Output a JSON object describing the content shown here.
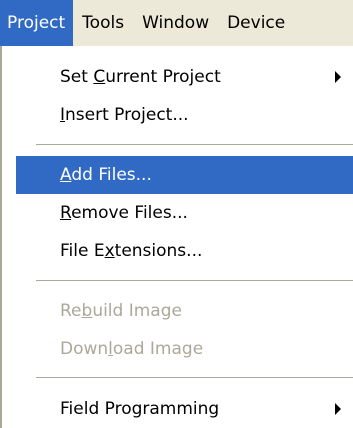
{
  "menubar": {
    "items": [
      "Project",
      "Tools",
      "Window",
      "Device"
    ],
    "active": "Project"
  },
  "menu": {
    "set_current_project": {
      "label": "Set Current Project",
      "mnemonic": "C",
      "has_submenu": true
    },
    "insert_project": {
      "label": "Insert Project...",
      "mnemonic": "I"
    },
    "add_files": {
      "label": "Add Files...",
      "mnemonic": "A",
      "highlighted": true
    },
    "remove_files": {
      "label": "Remove Files...",
      "mnemonic": "R"
    },
    "file_extensions": {
      "label": "File Extensions...",
      "mnemonic": "x"
    },
    "rebuild_image": {
      "label": "Rebuild Image",
      "mnemonic": "b",
      "disabled": true
    },
    "download_image": {
      "label": "Download Image",
      "mnemonic": "l",
      "disabled": true
    },
    "field_programming": {
      "label": "Field Programming",
      "has_submenu": true
    }
  },
  "colors": {
    "highlight": "#316ac5",
    "menubar_bg": "#ece9d8",
    "disabled_text": "#aca899"
  }
}
